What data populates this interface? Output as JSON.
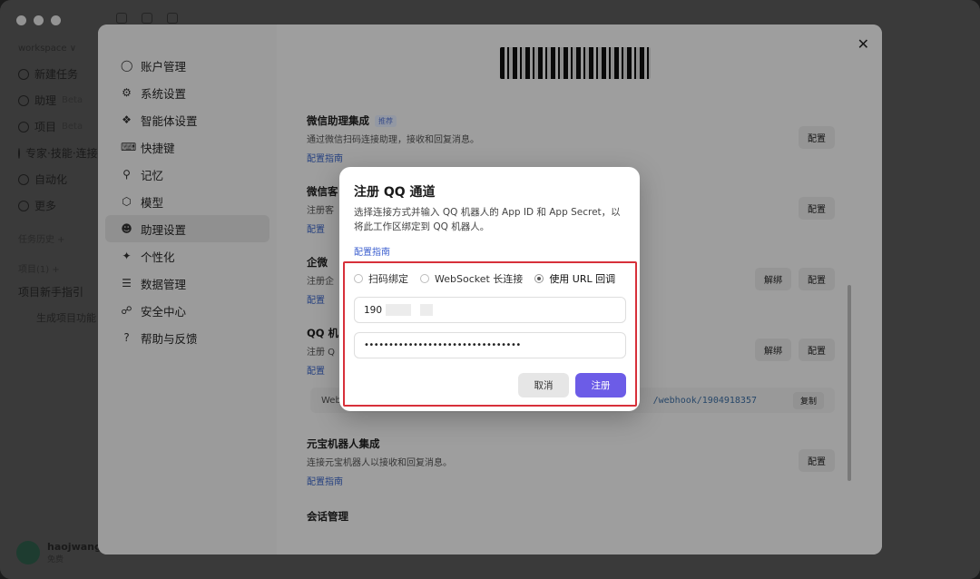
{
  "app": {
    "workspace_name": "workspace ∨",
    "nav": [
      {
        "label": "新建任务",
        "sub": ""
      },
      {
        "label": "助理",
        "sub": "Beta"
      },
      {
        "label": "项目",
        "sub": "Beta"
      },
      {
        "label": "专家·技能·连接",
        "sub": ""
      },
      {
        "label": "自动化",
        "sub": ""
      },
      {
        "label": "更多",
        "sub": ""
      }
    ],
    "section_tasks": "任务历史 +",
    "section_projects": "项目(1) +",
    "projects": [
      "项目新手指引",
      "生成项目功能"
    ],
    "user": {
      "name": "haojwang",
      "plan": "免费"
    }
  },
  "settings": {
    "nav": [
      {
        "label": "账户管理",
        "icon": "user-icon"
      },
      {
        "label": "系统设置",
        "icon": "gear-icon"
      },
      {
        "label": "智能体设置",
        "icon": "puzzle-icon"
      },
      {
        "label": "快捷键",
        "icon": "keyboard-icon"
      },
      {
        "label": "记忆",
        "icon": "pin-icon"
      },
      {
        "label": "模型",
        "icon": "cube-icon"
      },
      {
        "label": "助理设置",
        "icon": "assistant-icon"
      },
      {
        "label": "个性化",
        "icon": "sparkle-icon"
      },
      {
        "label": "数据管理",
        "icon": "database-icon"
      },
      {
        "label": "安全中心",
        "icon": "shield-icon"
      },
      {
        "label": "帮助与反馈",
        "icon": "help-icon"
      }
    ],
    "active_nav": "助理设置",
    "cards": [
      {
        "title": "微信助理集成",
        "badge": "推荐",
        "desc": "通过微信扫码连接助理，接收和回复消息。",
        "link": "配置指南",
        "btns": [
          "配置"
        ]
      },
      {
        "title": "微信客",
        "badge": "",
        "desc": "注册客",
        "link": "配置",
        "btns": [
          "配置"
        ]
      },
      {
        "title": "企微",
        "badge": "",
        "desc": "注册企",
        "link": "配置",
        "btns": [
          "解绑",
          "配置"
        ]
      },
      {
        "title": "QQ 机",
        "badge": "",
        "desc": "注册 Q",
        "link": "配置",
        "btns": [
          "解绑",
          "配置"
        ]
      },
      {
        "title": "元宝机器人集成",
        "badge": "",
        "desc": "连接元宝机器人以接收和回复消息。",
        "link": "配置指南",
        "btns": [
          "配置"
        ]
      }
    ],
    "webhook": {
      "prefix": "Web",
      "url": "/webhook/1904918357",
      "copy": "复制"
    },
    "session_title": "会话管理"
  },
  "dialog": {
    "title": "注册 QQ 通道",
    "desc": "选择连接方式并输入 QQ 机器人的 App ID 和 App Secret，以将此工作区绑定到 QQ 机器人。",
    "guide_link": "配置指南",
    "options": [
      "扫码绑定",
      "WebSocket 长连接",
      "使用 URL 回调"
    ],
    "selected_option": "使用 URL 回调",
    "app_id": "190",
    "app_secret": "••••••••••••••••••••••••••••••••",
    "cancel_label": "取消",
    "submit_label": "注册",
    "highlight_color": "#d7303a",
    "accent_color": "#6c5ce7"
  }
}
